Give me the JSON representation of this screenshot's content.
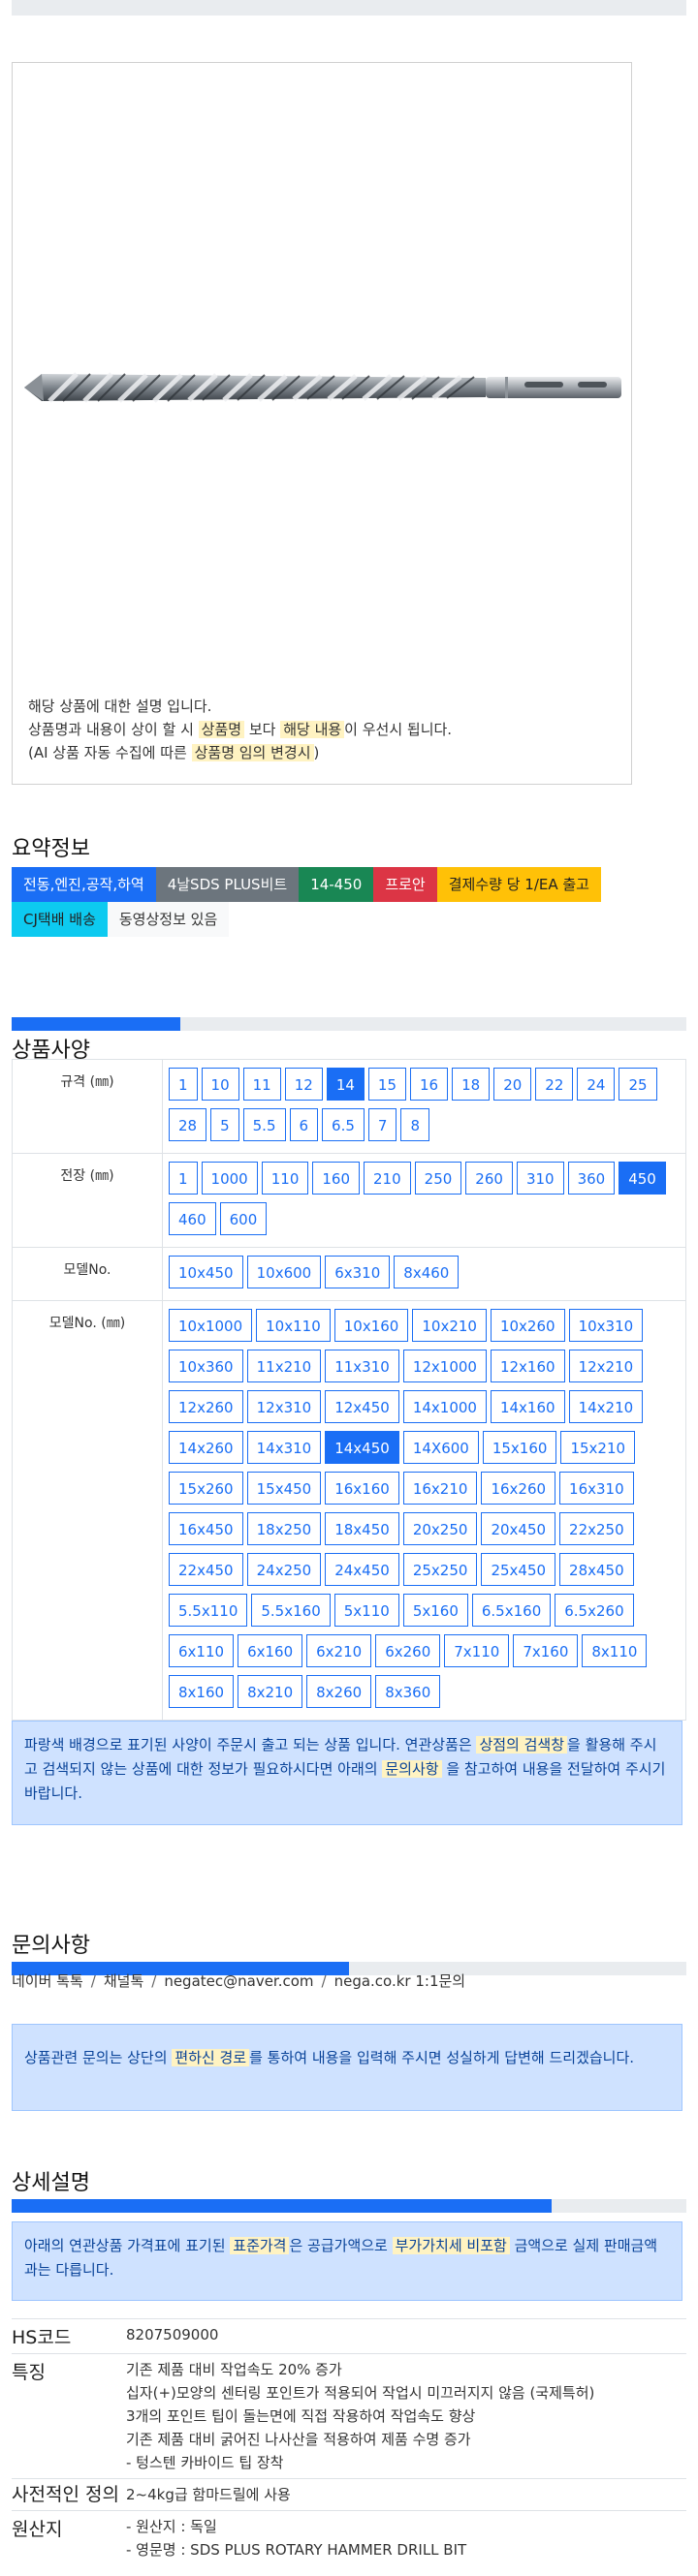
{
  "product_image": {
    "note_line1": "해당 상품에 대한 설명 입니다.",
    "note_line2_a": "상품명과 내용이 상이 할 시 ",
    "note_line2_b": "상품명",
    "note_line2_c": " 보다 ",
    "note_line2_d": "해당 내용",
    "note_line2_e": "이 우선시 됩니다.",
    "note_line3_a": "(AI 상품 자동 수집에 따른 ",
    "note_line3_b": "상품명 임의 변경시",
    "note_line3_c": ")"
  },
  "summary": {
    "title": "요약정보",
    "tags": [
      {
        "label": "전동,엔진,공작,하역",
        "color": "#1a6ef5",
        "text_color": "#ffffff"
      },
      {
        "label": "4날SDS PLUS비트",
        "color": "#6c757d",
        "text_color": "#ffffff"
      },
      {
        "label": "14-450",
        "color": "#198754",
        "text_color": "#ffffff"
      },
      {
        "label": "프로안",
        "color": "#dc3545",
        "text_color": "#ffffff"
      },
      {
        "label": "결제수량 당 1/EA 출고",
        "color": "#ffc107",
        "text_color": "#222222"
      },
      {
        "label": "CJ택배 배송",
        "color": "#0dcaf0",
        "text_color": "#222222"
      },
      {
        "label": "동영상정보 있음",
        "color": "#f8f9fa",
        "text_color": "#333333"
      }
    ]
  },
  "spec": {
    "title": "상품사양",
    "progress_pct": 25,
    "rows": [
      {
        "label": "규격 (㎜)",
        "options": [
          "1",
          "10",
          "11",
          "12",
          "14",
          "15",
          "16",
          "18",
          "20",
          "22",
          "24",
          "25",
          "28",
          "5",
          "5.5",
          "6",
          "6.5",
          "7",
          "8"
        ],
        "selected": "14"
      },
      {
        "label": "전장 (㎜)",
        "options": [
          "1",
          "1000",
          "110",
          "160",
          "210",
          "250",
          "260",
          "310",
          "360",
          "450",
          "460",
          "600"
        ],
        "selected": "450"
      },
      {
        "label": "모델No.",
        "options": [
          "10x450",
          "10x600",
          "6x310",
          "8x460"
        ],
        "selected": ""
      },
      {
        "label": "모델No. (㎜)",
        "options": [
          "10x1000",
          "10x110",
          "10x160",
          "10x210",
          "10x260",
          "10x310",
          "10x360",
          "11x210",
          "11x310",
          "12x1000",
          "12x160",
          "12x210",
          "12x260",
          "12x310",
          "12x450",
          "14x1000",
          "14x160",
          "14x210",
          "14x260",
          "14x310",
          "14x450",
          "14X600",
          "15x160",
          "15x210",
          "15x260",
          "15x450",
          "16x160",
          "16x210",
          "16x260",
          "16x310",
          "16x450",
          "18x250",
          "18x450",
          "20x250",
          "20x450",
          "22x250",
          "22x450",
          "24x250",
          "24x450",
          "25x250",
          "25x450",
          "28x450",
          "5.5x110",
          "5.5x160",
          "5x110",
          "5x160",
          "6.5x160",
          "6.5x260",
          "6x110",
          "6x160",
          "6x210",
          "6x260",
          "7x110",
          "7x160",
          "8x110",
          "8x160",
          "8x210",
          "8x260",
          "8x360"
        ],
        "selected": "14x450"
      }
    ],
    "info_a": "파랑색 배경으로 표기된 사양이 주문시 출고 되는 상품 입니다. 연관상품은 ",
    "info_b": "상점의 검색창",
    "info_c": "을 활용해 주시고 검색되지 않는 상품에 대한 정보가 필요하시다면 아래의 ",
    "info_d": "문의사항",
    "info_e": " 을 참고하여 내용을 전달하여 주시기 바랍니다."
  },
  "inquiry": {
    "title": "문의사항",
    "progress_pct": 50,
    "contacts": [
      "네이버 톡톡",
      "채널톡",
      "negatec@naver.com",
      "nega.co.kr 1:1문의"
    ],
    "info_a": "상품관련 문의는 상단의 ",
    "info_b": "편하신 경로",
    "info_c": "를 통하여 내용을 입력해 주시면 성실하게 답변해 드리겠습니다."
  },
  "detail": {
    "title": "상세설명",
    "progress_pct": 80,
    "info_a": "아래의 연관상품 가격표에 표기된 ",
    "info_b": "표준가격",
    "info_c": "은 공급가액으로 ",
    "info_d": "부가가치세 비포함",
    "info_e": " 금액으로 실제 판매금액과는 다릅니다.",
    "hs_label": "HS코드",
    "hs_value": "8207509000",
    "feature_label": "특징",
    "features": [
      "기존 제품 대비 작업속도 20% 증가",
      "십자(+)모양의 센터링 포인트가 적용되어 작업시 미끄러지지 않음 (국제특허)",
      "3개의 포인트 팁이 돌는면에 직접 작용하여 작업속도 향상",
      "기존 제품 대비 굵어진 나사산을 적용하여 제품 수명 증가",
      "- 텅스텐 카바이드 팁 장착"
    ],
    "def_label": "사전적인 정의",
    "def_value": "2~4kg급 함마드릴에 사용",
    "origin_label": "원산지",
    "origin_lines": [
      "- 원산지 : 독일",
      "- 영문명 : SDS PLUS ROTARY HAMMER DRILL BIT"
    ]
  }
}
